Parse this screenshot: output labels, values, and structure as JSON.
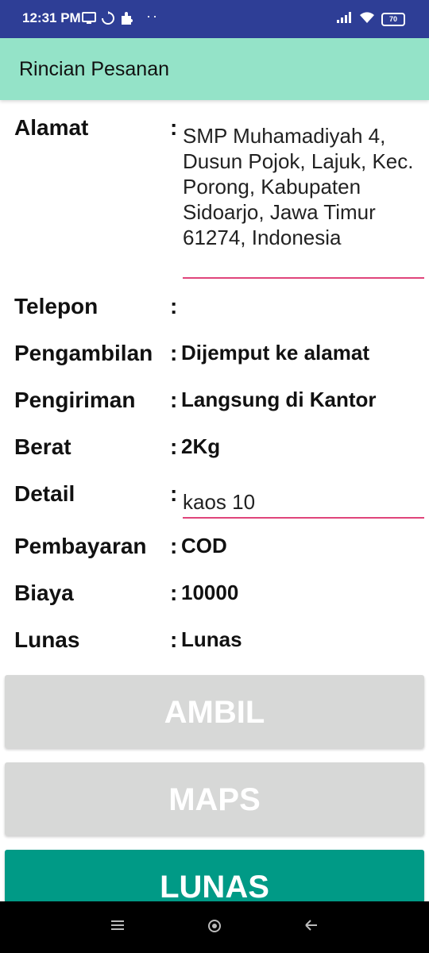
{
  "status_bar": {
    "time": "12:31 PM",
    "battery": "70",
    "icons": [
      "screen-icon",
      "sync-icon",
      "puzzle-icon",
      "signal-icon",
      "wifi-icon",
      "battery-icon"
    ]
  },
  "app_bar": {
    "title": "Rincian Pesanan"
  },
  "details": {
    "alamat": {
      "label": "Alamat",
      "colon": ":",
      "lines": [
        "SMP Muhamadiyah 4,",
        "Dusun Pojok, Lajuk, Kec.",
        "Porong, Kabupaten",
        "Sidoarjo, Jawa Timur",
        "61274, Indonesia"
      ]
    },
    "telepon": {
      "label": "Telepon",
      "colon": ":",
      "value": ""
    },
    "pengambilan": {
      "label": "Pengambilan",
      "colon": ":",
      "value": "Dijemput ke alamat"
    },
    "pengiriman": {
      "label": "Pengiriman",
      "colon": ":",
      "value": "Langsung di Kantor"
    },
    "berat": {
      "label": "Berat",
      "colon": ":",
      "value": "2Kg"
    },
    "detail": {
      "label": "Detail",
      "colon": ":",
      "value": "kaos 10"
    },
    "pembayaran": {
      "label": "Pembayaran",
      "colon": ":",
      "value": "COD"
    },
    "biaya": {
      "label": "Biaya",
      "colon": ":",
      "value": "10000"
    },
    "lunas": {
      "label": "Lunas",
      "colon": ":",
      "value": "Lunas"
    }
  },
  "buttons": {
    "ambil": "AMBIL",
    "maps": "MAPS",
    "lunas": "LUNAS"
  },
  "colors": {
    "status_bar": "#2E3E96",
    "app_bar": "#94E3C8",
    "accent": "#009A86",
    "underline": "#E0457B",
    "disabled": "#D7D8D7"
  }
}
